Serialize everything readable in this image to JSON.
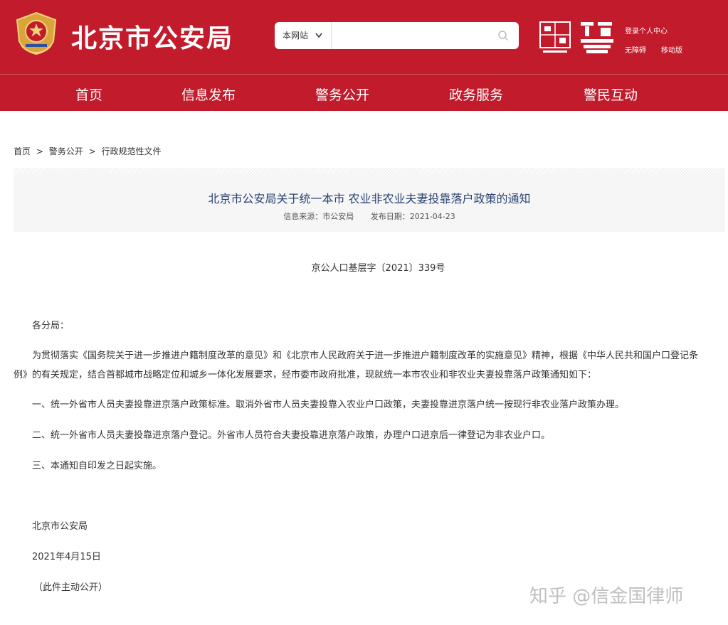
{
  "header": {
    "site_title": "北京市公安局",
    "search": {
      "scope": "本网站",
      "value": "",
      "placeholder": ""
    },
    "links": {
      "login": "登录个人中心",
      "accessibility": "无障碍",
      "mobile": "移动版"
    },
    "nav": [
      "首页",
      "信息发布",
      "警务公开",
      "政务服务",
      "警民互动"
    ],
    "brand_color": "#c21b2c"
  },
  "breadcrumb": {
    "home": "首页",
    "sep1": ">",
    "level1": "警务公开",
    "sep2": ">",
    "level2": "行政规范性文件"
  },
  "article": {
    "title": "北京市公安局关于统一本市 农业非农业夫妻投靠落户政策的通知",
    "source": "信息来源：市公安局",
    "date": "发布日期：2021-04-23",
    "doc_number": "京公人口基层字〔2021〕339号",
    "salutation": "各分局：",
    "intro_line1": "为贯彻落实《国务院关于进一步推进户籍制度改革的意见》和《北京市人民政府关于进一步推进户籍制度改革的实施意见》精神，根据《中华人民共和国户口登记条",
    "intro_line2": "例》的有关规定，结合首都城市战略定位和城乡一体化发展要求，经市委市政府批准，现就统一本市农业和非农业夫妻投靠落户政策通知如下：",
    "item1": "一、统一外省市人员夫妻投靠进京落户政策标准。取消外省市人员夫妻投靠入农业户口政策，夫妻投靠进京落户统一按现行非农业落户政策办理。",
    "item2": "二、统一外省市人员夫妻投靠进京落户登记。外省市人员符合夫妻投靠进京落户政策，办理户口进京后一律登记为非农业户口。",
    "item3": "三、本通知自印发之日起实施。",
    "signature": "北京市公安局",
    "sign_date": "2021年4月15日",
    "disclosure": "（此件主动公开）"
  },
  "watermark": "知乎 @信金国律师"
}
